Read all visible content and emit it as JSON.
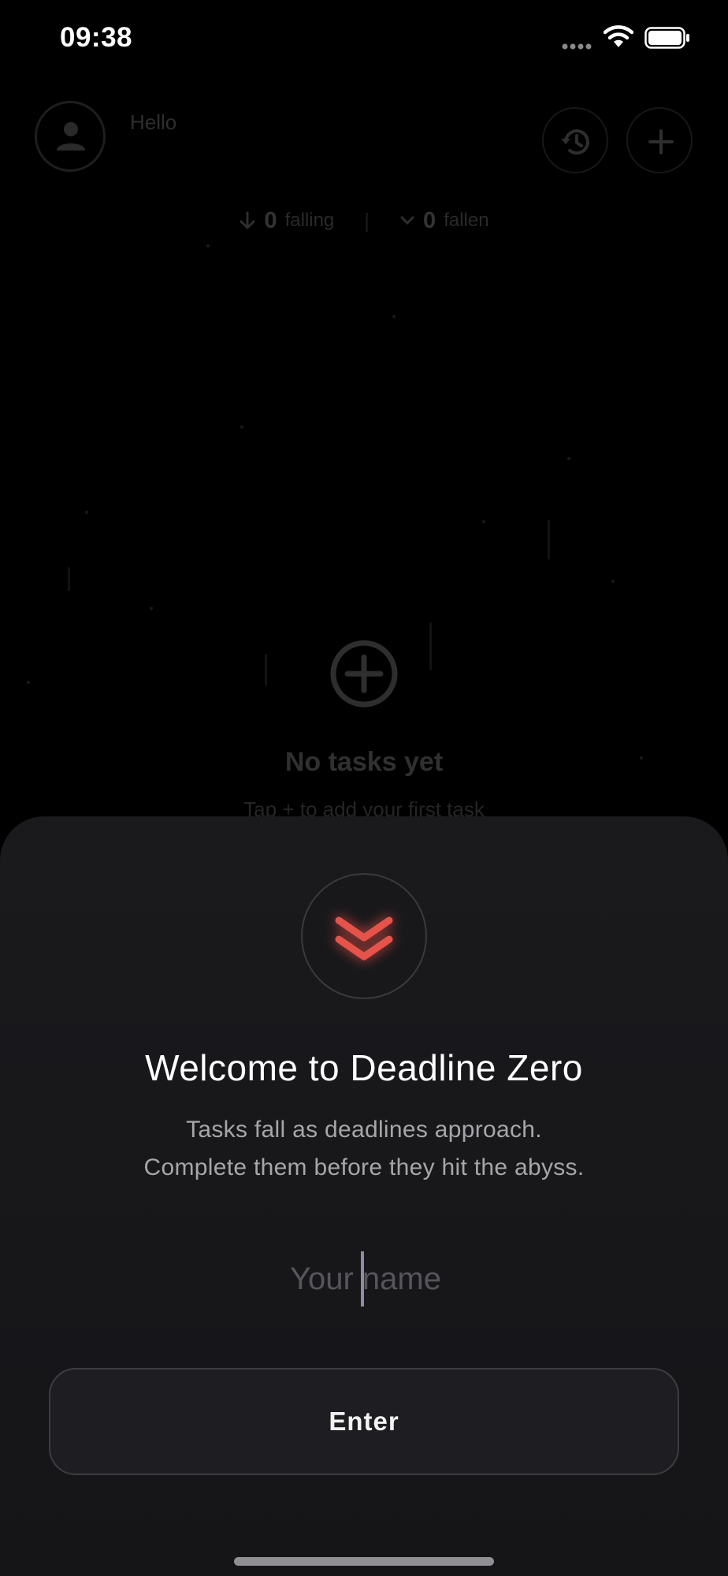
{
  "status_bar": {
    "time": "09:38",
    "icons": [
      "signal-icon",
      "wifi-icon",
      "battery-icon"
    ]
  },
  "background_app": {
    "greeting": "Hello",
    "counters": [
      {
        "icon": "arrow-down-icon",
        "value": "0",
        "label": "falling"
      },
      {
        "icon": "chevron-down-icon",
        "value": "0",
        "label": "fallen"
      }
    ],
    "divider": "|",
    "empty_state": {
      "icon": "plus-circle-icon",
      "title": "No tasks yet",
      "subtitle": "Tap + to add your first task"
    }
  },
  "sheet": {
    "logo_icon": "double-chevron-down-icon",
    "title": "Welcome to Deadline Zero",
    "subtitle_line1": "Tasks fall as deadlines approach.",
    "subtitle_line2": "Complete them before they hit the abyss.",
    "name_input": {
      "placeholder": "Your name",
      "value": ""
    },
    "enter_label": "Enter"
  },
  "colors": {
    "background": "#000000",
    "sheet": "#1a1a1d",
    "accent": "#e5534b",
    "text_primary": "#ffffff",
    "text_secondary": "#a6a6aa"
  }
}
